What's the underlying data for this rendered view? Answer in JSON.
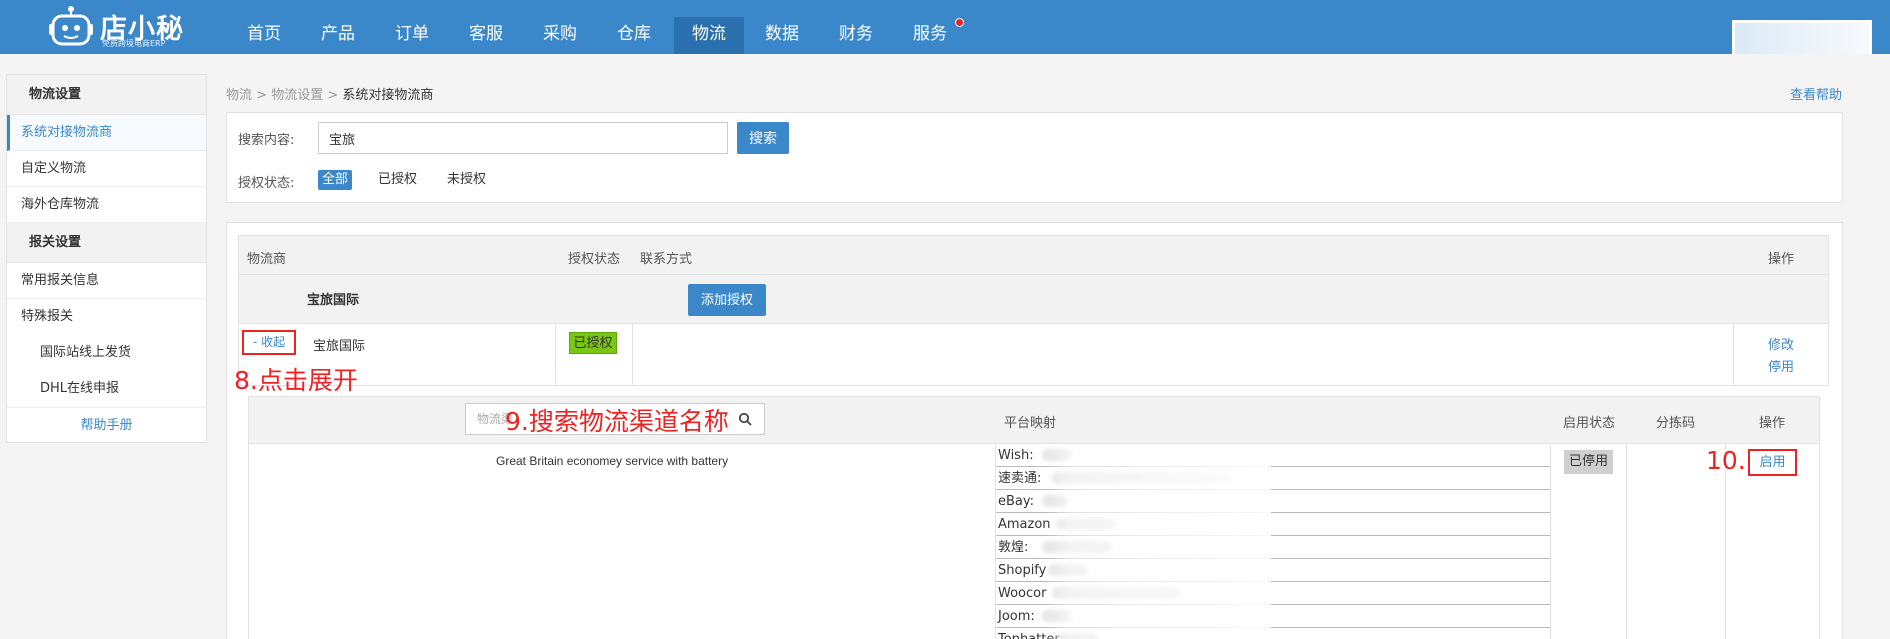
{
  "app": {
    "logo_name": "店小秘",
    "logo_sub": "免费跨境电商ERP",
    "brand_color": "#3a87c9"
  },
  "nav": [
    {
      "label": "首页"
    },
    {
      "label": "产品"
    },
    {
      "label": "订单"
    },
    {
      "label": "客服"
    },
    {
      "label": "采购"
    },
    {
      "label": "仓库"
    },
    {
      "label": "物流",
      "active": true
    },
    {
      "label": "数据"
    },
    {
      "label": "财务"
    },
    {
      "label": "服务"
    }
  ],
  "sidebar": {
    "section1": "物流设置",
    "items1": [
      "系统对接物流商",
      "自定义物流",
      "海外仓库物流"
    ],
    "section2": "报关设置",
    "items2": [
      "常用报关信息",
      "特殊报关"
    ],
    "sub_items": [
      "国际站线上发货",
      "DHL在线申报"
    ],
    "help": "帮助手册"
  },
  "breadcrumb": {
    "part1": "物流",
    "part2": "物流设置",
    "current": "系统对接物流商",
    "sep": ">"
  },
  "help_link": "查看帮助",
  "search": {
    "label": "搜索内容:",
    "value": "宝旅",
    "button": "搜索",
    "status_label": "授权状态:",
    "filters": [
      "全部",
      "已授权",
      "未授权"
    ]
  },
  "table": {
    "headers": {
      "carrier": "物流商",
      "auth": "授权状态",
      "contact": "联系方式",
      "ops": "操作"
    },
    "group_name": "宝旅国际",
    "add_auth_button": "添加授权",
    "row": {
      "collapse": "- 收起",
      "name": "宝旅国际",
      "auth_status": "已授权",
      "op_edit": "修改",
      "op_disable": "停用"
    }
  },
  "annotations": {
    "a8": "8.点击展开",
    "a9": "9.搜索物流渠道名称",
    "a10": "10."
  },
  "channels": {
    "search_placeholder": "物流渠",
    "headers": {
      "mapping": "平台映射",
      "status": "启用状态",
      "sort_code": "分拣码",
      "ops": "操作"
    },
    "name": "Great Britain economey service with battery",
    "status": "已停用",
    "enable": "启用",
    "mappings": [
      "Wish:",
      "速卖通:",
      "eBay:",
      "Amazon",
      "敦煌:",
      "Shopify",
      "Woocor",
      "Joom:",
      "Tophatter:"
    ]
  }
}
